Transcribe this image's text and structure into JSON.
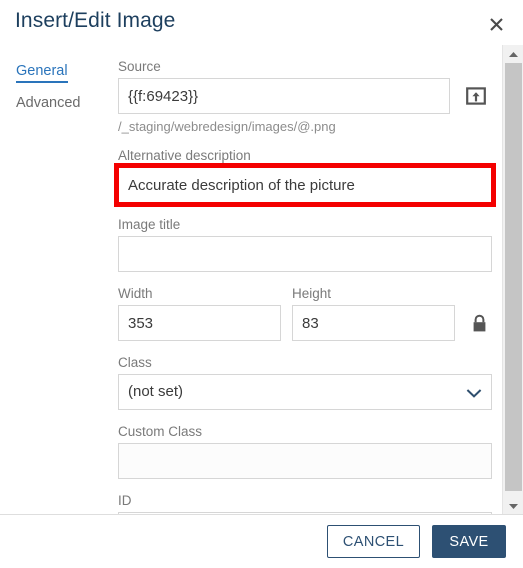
{
  "dialog": {
    "title": "Insert/Edit Image",
    "close_icon": "close-icon"
  },
  "tabs": [
    {
      "label": "General",
      "active": true
    },
    {
      "label": "Advanced",
      "active": false
    }
  ],
  "form": {
    "source": {
      "label": "Source",
      "value": "{{f:69423}}",
      "placeholder": "",
      "help": "/_staging/webredesign/images/@.png",
      "upload_icon": "upload-icon"
    },
    "alt_description": {
      "label": "Alternative description",
      "value": "Accurate description of the picture",
      "placeholder": "",
      "highlight_color": "#f40000"
    },
    "image_title": {
      "label": "Image title",
      "value": "",
      "placeholder": ""
    },
    "width": {
      "label": "Width",
      "value": "353",
      "placeholder": ""
    },
    "height": {
      "label": "Height",
      "value": "83",
      "placeholder": ""
    },
    "constrain": {
      "icon": "lock-closed-icon"
    },
    "class": {
      "label": "Class",
      "value": "(not set)",
      "chevron_icon": "chevron-down-icon"
    },
    "custom_class": {
      "label": "Custom Class",
      "value": "",
      "placeholder": ""
    },
    "id": {
      "label": "ID",
      "value": "",
      "placeholder": ""
    }
  },
  "scrollbar": {
    "up_icon": "caret-up-icon",
    "down_icon": "caret-down-icon"
  },
  "footer": {
    "cancel_label": "CANCEL",
    "save_label": "SAVE",
    "save_color": "#2d5073"
  }
}
